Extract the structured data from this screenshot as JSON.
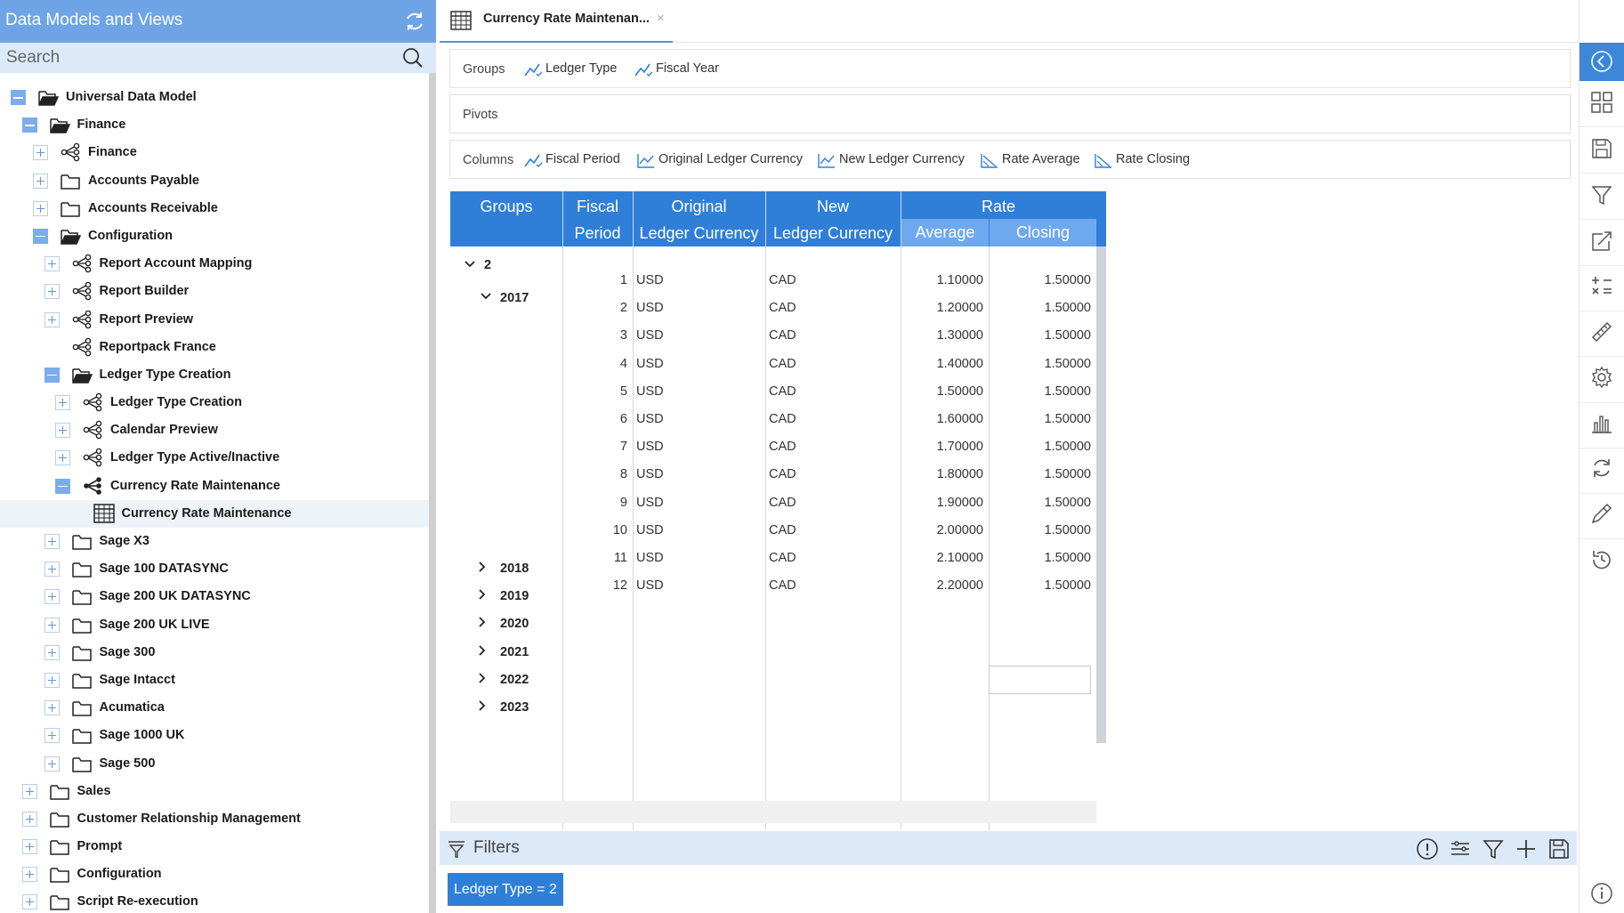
{
  "sidebar": {
    "title": "Data Models and Views",
    "search_placeholder": "Search",
    "tree": [
      {
        "label": "Universal Data Model",
        "level": 0,
        "toggle": "minus",
        "icon": "folder-open-icon"
      },
      {
        "label": "Finance",
        "level": 1,
        "toggle": "minus",
        "icon": "folder-open-icon"
      },
      {
        "label": "Finance",
        "level": 2,
        "toggle": "plus",
        "icon": "data-model-icon"
      },
      {
        "label": "Accounts Payable",
        "level": 2,
        "toggle": "plus",
        "icon": "folder-icon"
      },
      {
        "label": "Accounts Receivable",
        "level": 2,
        "toggle": "plus",
        "icon": "folder-icon"
      },
      {
        "label": "Configuration",
        "level": 2,
        "toggle": "minus",
        "icon": "folder-open-icon"
      },
      {
        "label": "Report Account Mapping",
        "level": 3,
        "toggle": "plus",
        "icon": "data-model-icon"
      },
      {
        "label": "Report Builder",
        "level": 3,
        "toggle": "plus",
        "icon": "data-model-icon"
      },
      {
        "label": "Report Preview",
        "level": 3,
        "toggle": "plus",
        "icon": "data-model-icon"
      },
      {
        "label": "Reportpack France",
        "level": 3,
        "toggle": "none",
        "icon": "data-model-icon"
      },
      {
        "label": "Ledger Type Creation",
        "level": 3,
        "toggle": "minus",
        "icon": "folder-open-icon"
      },
      {
        "label": "Ledger Type Creation",
        "level": 4,
        "toggle": "plus",
        "icon": "data-model-icon"
      },
      {
        "label": "Calendar Preview",
        "level": 4,
        "toggle": "plus",
        "icon": "data-model-icon"
      },
      {
        "label": "Ledger Type Active/Inactive",
        "level": 4,
        "toggle": "plus",
        "icon": "data-model-icon"
      },
      {
        "label": "Currency Rate Maintenance",
        "level": 4,
        "toggle": "minus",
        "icon": "data-model-filled-icon"
      },
      {
        "label": "Currency Rate Maintenance",
        "level": 5,
        "toggle": "none",
        "icon": "grid-view-icon",
        "selected": true
      },
      {
        "label": "Sage X3",
        "level": 3,
        "toggle": "plus",
        "icon": "folder-icon"
      },
      {
        "label": "Sage 100 DATASYNC",
        "level": 3,
        "toggle": "plus",
        "icon": "folder-icon"
      },
      {
        "label": "Sage 200 UK DATASYNC",
        "level": 3,
        "toggle": "plus",
        "icon": "folder-icon"
      },
      {
        "label": "Sage 200 UK LIVE",
        "level": 3,
        "toggle": "plus",
        "icon": "folder-icon"
      },
      {
        "label": "Sage 300",
        "level": 3,
        "toggle": "plus",
        "icon": "folder-icon"
      },
      {
        "label": "Sage Intacct",
        "level": 3,
        "toggle": "plus",
        "icon": "folder-icon"
      },
      {
        "label": "Acumatica",
        "level": 3,
        "toggle": "plus",
        "icon": "folder-icon"
      },
      {
        "label": "Sage 1000 UK",
        "level": 3,
        "toggle": "plus",
        "icon": "folder-icon"
      },
      {
        "label": "Sage 500",
        "level": 3,
        "toggle": "plus",
        "icon": "folder-icon"
      },
      {
        "label": "Sales",
        "level": 1,
        "toggle": "plus",
        "icon": "folder-icon"
      },
      {
        "label": "Customer Relationship Management",
        "level": 1,
        "toggle": "plus",
        "icon": "folder-icon"
      },
      {
        "label": "Prompt",
        "level": 1,
        "toggle": "plus",
        "icon": "folder-icon"
      },
      {
        "label": "Configuration",
        "level": 1,
        "toggle": "plus",
        "icon": "folder-icon"
      },
      {
        "label": "Script Re-execution",
        "level": 1,
        "toggle": "plus",
        "icon": "folder-icon"
      }
    ]
  },
  "tab": {
    "title": "Currency Rate Maintenan...",
    "close": "×"
  },
  "groups_row": {
    "label": "Groups",
    "items": [
      "Ledger Type",
      "Fiscal Year"
    ]
  },
  "pivots_row": {
    "label": "Pivots"
  },
  "columns_row": {
    "label": "Columns",
    "items": [
      {
        "label": "Fiscal Period",
        "icon": "dimension-icon"
      },
      {
        "label": "Original Ledger Currency",
        "icon": "line-chart-icon"
      },
      {
        "label": "New Ledger Currency",
        "icon": "line-chart-icon"
      },
      {
        "label": "Rate Average",
        "icon": "measure-icon"
      },
      {
        "label": "Rate Closing",
        "icon": "measure-icon"
      }
    ]
  },
  "grid": {
    "headers": {
      "groups": "Groups",
      "fiscal_1": "Fiscal",
      "fiscal_2": "Period",
      "orig_1": "Original",
      "orig_2": "Ledger Currency",
      "new_1": "New",
      "new_2": "Ledger Currency",
      "rate": "Rate",
      "average": "Average",
      "closing": "Closing"
    },
    "group_level1": "2",
    "year_expanded": "2017",
    "rows": [
      {
        "period": "1",
        "orig": "USD",
        "new": "CAD",
        "average": "1.10000",
        "closing": "1.50000"
      },
      {
        "period": "2",
        "orig": "USD",
        "new": "CAD",
        "average": "1.20000",
        "closing": "1.50000"
      },
      {
        "period": "3",
        "orig": "USD",
        "new": "CAD",
        "average": "1.30000",
        "closing": "1.50000"
      },
      {
        "period": "4",
        "orig": "USD",
        "new": "CAD",
        "average": "1.40000",
        "closing": "1.50000"
      },
      {
        "period": "5",
        "orig": "USD",
        "new": "CAD",
        "average": "1.50000",
        "closing": "1.50000"
      },
      {
        "period": "6",
        "orig": "USD",
        "new": "CAD",
        "average": "1.60000",
        "closing": "1.50000"
      },
      {
        "period": "7",
        "orig": "USD",
        "new": "CAD",
        "average": "1.70000",
        "closing": "1.50000"
      },
      {
        "period": "8",
        "orig": "USD",
        "new": "CAD",
        "average": "1.80000",
        "closing": "1.50000"
      },
      {
        "period": "9",
        "orig": "USD",
        "new": "CAD",
        "average": "1.90000",
        "closing": "1.50000"
      },
      {
        "period": "10",
        "orig": "USD",
        "new": "CAD",
        "average": "2.00000",
        "closing": "1.50000"
      },
      {
        "period": "11",
        "orig": "USD",
        "new": "CAD",
        "average": "2.10000",
        "closing": "1.50000"
      },
      {
        "period": "12",
        "orig": "USD",
        "new": "CAD",
        "average": "2.20000",
        "closing": "1.50000"
      }
    ],
    "collapsed_years": [
      "2018",
      "2019",
      "2020",
      "2021",
      "2022",
      "2023"
    ]
  },
  "filters": {
    "title": "Filters",
    "chip": "Ledger Type = 2",
    "tools": [
      "info-icon",
      "list-settings-icon",
      "filter-icon",
      "plus-icon",
      "save-icon"
    ]
  },
  "right_toolbar": {
    "icons": [
      "collapse-panel-icon",
      "dashboard-icon",
      "save-icon",
      "filter-icon",
      "export-icon",
      "calculator-icon",
      "ruler-icon",
      "settings-gear-icon",
      "bar-chart-icon",
      "refresh-icon",
      "pipette-icon",
      "history-icon",
      "info-icon"
    ]
  },
  "colors": {
    "accent": "#2f7fd8",
    "sidebar_header": "#6ea4e6",
    "search_bg": "#dce9f8",
    "header_sub": "#6ea9f0"
  }
}
